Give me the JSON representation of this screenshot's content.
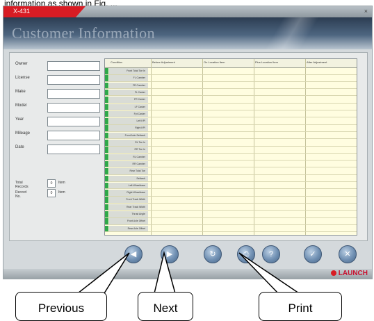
{
  "caption": "information as shown in Fig. ...",
  "window": {
    "app_label": "X-431",
    "header_title": "Customer Information",
    "close_glyph": "×"
  },
  "form": {
    "fields": [
      {
        "label": "Owner"
      },
      {
        "label": "License"
      },
      {
        "label": "Make"
      },
      {
        "label": "Model"
      },
      {
        "label": "Year"
      },
      {
        "label": "Mileage"
      },
      {
        "label": "Date"
      }
    ],
    "small_fields": [
      {
        "label": "Total Records",
        "value": "0",
        "unit": "Item"
      },
      {
        "label": "Record No.",
        "value": "0",
        "unit": "Item"
      }
    ]
  },
  "table": {
    "columns": [
      "Condition",
      "Before Adjustment",
      "On Location Item",
      "Plus Location Item",
      "After Adjustment"
    ],
    "rows": [
      "Front Total Toe In",
      "FL Camber",
      "FR Camber",
      "FL Caster",
      "FR Caster",
      "LF Caster",
      "Fpt Caster",
      "Left KPI",
      "Right KPI",
      "Front Axle Setback",
      "RL Toe In",
      "RR Toe In",
      "RL Camber",
      "RR Camber",
      "Rear Total Toe",
      "Setback",
      "Left Wheelbase",
      "Right Wheelbase",
      "Front Track Width",
      "Rear Track Width",
      "Thrust Angle",
      "Front Axle Offset",
      "Rear Axle Offset"
    ]
  },
  "buttons": [
    {
      "name": "previous-button",
      "glyph": "◀"
    },
    {
      "name": "next-button",
      "glyph": "▶"
    },
    {
      "name": "refresh-button",
      "glyph": "↻"
    },
    {
      "name": "print-button",
      "glyph": "⎙"
    },
    {
      "name": "help-button",
      "glyph": "?"
    },
    {
      "name": "ok-button",
      "glyph": "✓"
    },
    {
      "name": "exit-button",
      "glyph": "✕"
    }
  ],
  "brand": "LAUNCH",
  "callouts": {
    "previous": "Previous",
    "next": "Next",
    "print": "Print"
  },
  "colors": {
    "header_dark": "#2c3d52",
    "title_tab_red": "#d81c24",
    "row_marker_green": "#2fa84a",
    "table_yellow": "#fffde0"
  }
}
